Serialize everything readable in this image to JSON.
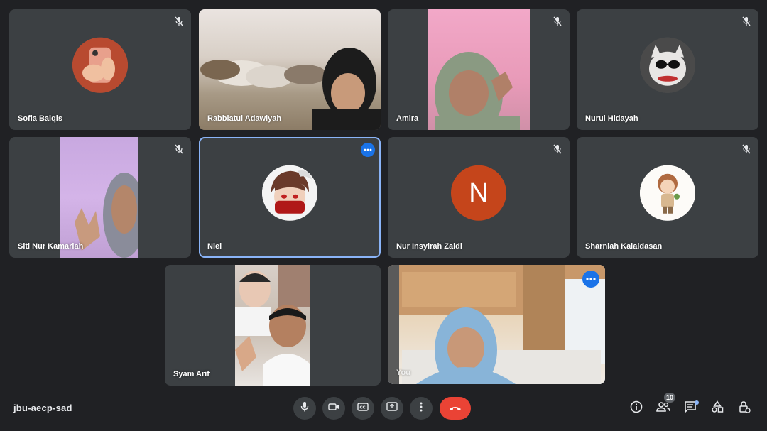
{
  "meeting": {
    "code": "jbu-aecp-sad"
  },
  "participants": [
    {
      "id": "sofia",
      "name": "Sofia Balqis",
      "muted": true
    },
    {
      "id": "rabbiatul",
      "name": "Rabbiatul Adawiyah",
      "muted": false
    },
    {
      "id": "amira",
      "name": "Amira",
      "muted": true
    },
    {
      "id": "nurul",
      "name": "Nurul Hidayah",
      "muted": true
    },
    {
      "id": "siti",
      "name": "Siti Nur Kamariah",
      "muted": true
    },
    {
      "id": "niel",
      "name": "Niel",
      "muted": false
    },
    {
      "id": "nur-insyirah",
      "name": "Nur Insyirah Zaidi",
      "muted": true,
      "avatar_letter": "N"
    },
    {
      "id": "sharniah",
      "name": "Sharniah Kalaidasan",
      "muted": true
    },
    {
      "id": "syam",
      "name": "Syam Arif",
      "muted": false
    },
    {
      "id": "you",
      "name": "You",
      "muted": false
    }
  ],
  "controls": {
    "mic": "microphone-icon",
    "camera": "camera-icon",
    "captions": "closed-captions-icon",
    "present": "present-screen-icon",
    "more": "more-options-icon",
    "hangup": "end-call-icon"
  },
  "right_panel": {
    "people_count": "10"
  },
  "colors": {
    "background": "#202124",
    "tile": "#3c4043",
    "active_border": "#8ab4f8",
    "hangup": "#ea4335",
    "accent": "#1a73e8"
  }
}
